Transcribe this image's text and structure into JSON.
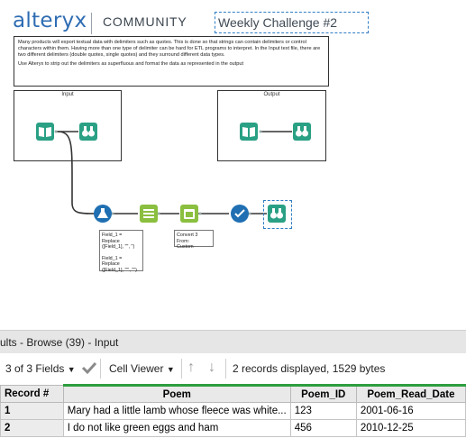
{
  "header": {
    "logo": "alteryx",
    "community": "COMMUNITY",
    "challenge_title": "Weekly Challenge #2"
  },
  "comment": {
    "para1": "Many products will export textual data with delimiters such as quotes.  This is done so that strings can contain delimiters or control characters within them.   Having more than one type of delimiter can be hard for ETL programs to interpret.  In the Input text file, there are two different delimiters (double quotes, single quotes) and they surround different data types.",
    "para2": "Use Alteryx to strip out the delimiters as superfluous and format the data as represented in the output"
  },
  "containers": {
    "input_label": "Input",
    "output_label": "Output"
  },
  "annotations": {
    "formula_line1": "Field_1 = Replace",
    "formula_line2": "([Field_1], '\"', '')",
    "formula_line3": "Field_1 = Replace",
    "formula_line4": "([Field_1], \"'\", \"\")",
    "convert_line1": "Convert 3 From:",
    "convert_line2": "Custom"
  },
  "results": {
    "title": "ults - Browse (39) - Input",
    "fields_label": "3 of 3 Fields",
    "viewer_label": "Cell Viewer",
    "summary": "2 records displayed, 1529 bytes"
  },
  "table": {
    "headers": [
      "Record #",
      "Poem",
      "Poem_ID",
      "Poem_Read_Date"
    ],
    "rows": [
      [
        "1",
        "Mary had a little lamb whose fleece was white...",
        "123",
        "2001-06-16"
      ],
      [
        "2",
        "I do not like green eggs and ham",
        "456",
        "2010-12-25"
      ]
    ]
  },
  "colors": {
    "brand_blue": "#2f6db3",
    "tool_green": "#2a9d8f",
    "tool_blue": "#1f6fb2",
    "tool_teal": "#2c9a86",
    "header_accent": "#2d9e3f"
  }
}
